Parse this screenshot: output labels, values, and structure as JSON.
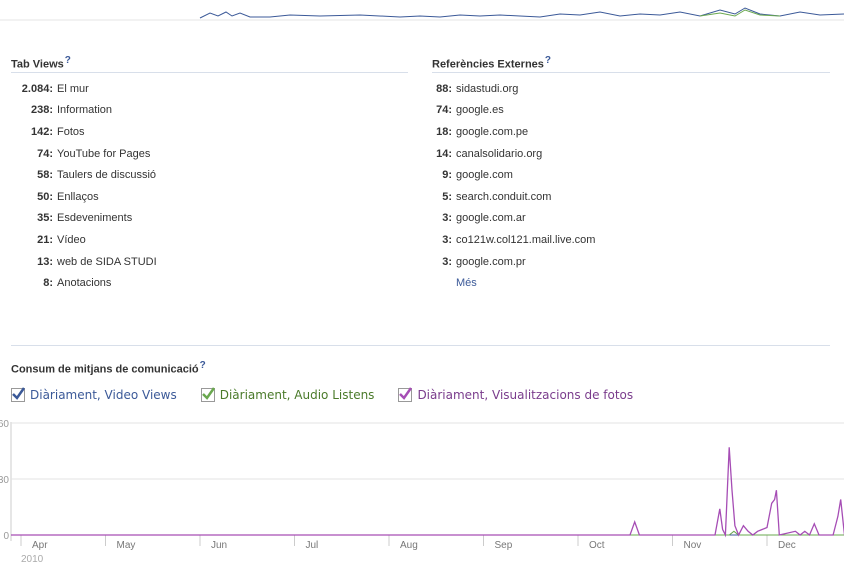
{
  "tab_views": {
    "title": "Tab Views",
    "help": "?",
    "items": [
      {
        "count": "2.084:",
        "label": "El mur"
      },
      {
        "count": "238:",
        "label": "Information"
      },
      {
        "count": "142:",
        "label": "Fotos"
      },
      {
        "count": "74:",
        "label": "YouTube for Pages"
      },
      {
        "count": "58:",
        "label": "Taulers de discussió"
      },
      {
        "count": "50:",
        "label": "Enllaços"
      },
      {
        "count": "35:",
        "label": "Esdeveniments"
      },
      {
        "count": "21:",
        "label": "Vídeo"
      },
      {
        "count": "13:",
        "label": "web de SIDA STUDI"
      },
      {
        "count": "8:",
        "label": "Anotacions"
      }
    ]
  },
  "external_refs": {
    "title": "Referències Externes",
    "help": "?",
    "items": [
      {
        "count": "88:",
        "label": "sidastudi.org"
      },
      {
        "count": "74:",
        "label": "google.es"
      },
      {
        "count": "18:",
        "label": "google.com.pe"
      },
      {
        "count": "14:",
        "label": "canalsolidario.org"
      },
      {
        "count": "9:",
        "label": "google.com"
      },
      {
        "count": "5:",
        "label": "search.conduit.com"
      },
      {
        "count": "3:",
        "label": "google.com.ar"
      },
      {
        "count": "3:",
        "label": "co121w.col121.mail.live.com"
      },
      {
        "count": "3:",
        "label": "google.com.pr"
      }
    ],
    "more_label": "Més"
  },
  "media": {
    "title": "Consum de mitjans de comunicació",
    "help": "?"
  },
  "legend": [
    {
      "label": "Diàriament, Video Views",
      "color": "#3b5998",
      "check_color": "#3b5998"
    },
    {
      "label": "Diàriament, Audio Listens",
      "color": "#4a7a2a",
      "check_color": "#6aa84f"
    },
    {
      "label": "Diàriament, Visualitzacions de fotos",
      "color": "#7a3c8c",
      "check_color": "#a64db5"
    }
  ],
  "chart_data": {
    "type": "line",
    "categories": [
      "Apr",
      "May",
      "Jun",
      "Jul",
      "Aug",
      "Sep",
      "Oct",
      "Nov",
      "Dec"
    ],
    "year_label": "2010",
    "ylim": [
      0,
      60
    ],
    "grid": true,
    "series": [
      {
        "name": "Diàriament, Video Views",
        "color": "#3b5998",
        "points": [
          [
            0,
            0
          ],
          [
            8.9,
            0
          ]
        ]
      },
      {
        "name": "Diàriament, Audio Listens",
        "color": "#6aa84f",
        "points": [
          [
            0,
            0
          ],
          [
            7.6,
            0
          ],
          [
            7.65,
            2
          ],
          [
            7.7,
            0
          ],
          [
            8.9,
            0
          ]
        ]
      },
      {
        "name": "Diàriament, Visualitzacions de fotos",
        "color": "#a64db5",
        "points": [
          [
            0,
            0
          ],
          [
            6.55,
            0
          ],
          [
            6.6,
            7
          ],
          [
            6.65,
            0
          ],
          [
            7.45,
            0
          ],
          [
            7.5,
            14
          ],
          [
            7.53,
            3
          ],
          [
            7.56,
            0
          ],
          [
            7.6,
            47
          ],
          [
            7.63,
            24
          ],
          [
            7.66,
            5
          ],
          [
            7.7,
            0
          ],
          [
            7.75,
            5
          ],
          [
            7.8,
            2
          ],
          [
            7.85,
            0
          ],
          [
            7.9,
            2
          ],
          [
            8.0,
            4
          ],
          [
            8.05,
            17
          ],
          [
            8.08,
            19
          ],
          [
            8.1,
            24
          ],
          [
            8.13,
            0
          ],
          [
            8.3,
            2
          ],
          [
            8.35,
            0
          ],
          [
            8.4,
            2
          ],
          [
            8.45,
            0
          ],
          [
            8.5,
            6
          ],
          [
            8.55,
            0
          ],
          [
            8.7,
            0
          ],
          [
            8.75,
            10
          ],
          [
            8.78,
            19
          ],
          [
            8.82,
            0
          ],
          [
            8.9,
            0
          ]
        ]
      }
    ]
  }
}
